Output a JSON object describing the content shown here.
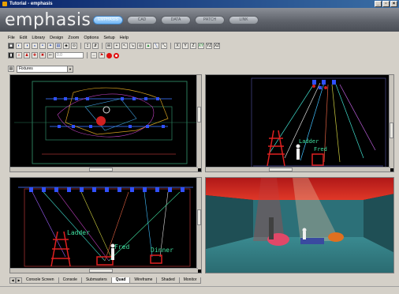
{
  "window": {
    "title": "Tutorial - emphasis"
  },
  "brand": {
    "name": "emphasis"
  },
  "mode_tabs": [
    {
      "label": "EMPHASIS"
    },
    {
      "label": "CAD"
    },
    {
      "label": "DATA"
    },
    {
      "label": "PATCH"
    },
    {
      "label": "LINK"
    }
  ],
  "menu": [
    "File",
    "Edit",
    "Library",
    "Design",
    "Zoom",
    "Options",
    "Setup",
    "Help"
  ],
  "layer_select": {
    "value": "Fixtures"
  },
  "coord_field": {
    "value": "0.0"
  },
  "toolbar_text": [
    "X",
    "Y",
    "Z",
    "XY",
    "YZ",
    "XZ"
  ],
  "view_labels": {
    "v2_ladder": "Ladder",
    "v2_fred": "Fred",
    "v3_ladder": "Ladder",
    "v3_fred": "Fred",
    "v3_dinner": "Dinner"
  },
  "sheet_tabs": [
    "Console Screen",
    "Console",
    "Submasters",
    "Quad",
    "Wireframe",
    "Shaded",
    "Monitor"
  ],
  "active_sheet_tab": "Quad",
  "colors": {
    "title_blue": "#0a246a",
    "accent_active_tab": "#6fb6f5",
    "viewport_bg": "#000000",
    "beam_red": "#e03020",
    "beam_cyan": "#40e0d0"
  }
}
